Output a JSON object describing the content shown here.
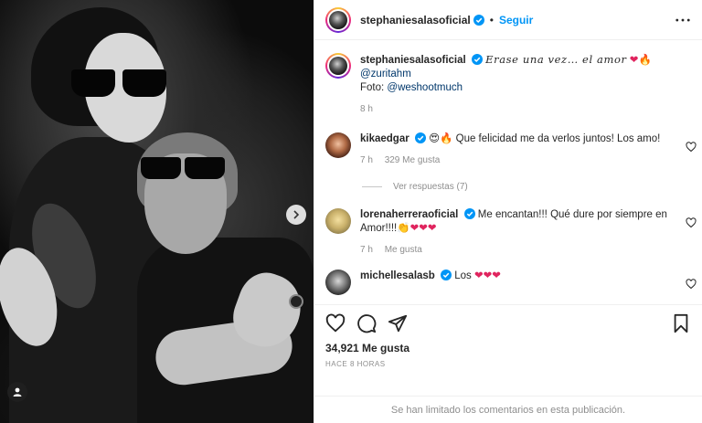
{
  "post": {
    "username": "stephaniesalasoficial",
    "follow_label": "Seguir",
    "dot": "•"
  },
  "caption": {
    "username": "stephaniesalasoficial",
    "title": "𝐸𝑟𝑎𝑠𝑒 𝑢𝑛𝑎 𝑣𝑒𝑧… 𝑒𝑙 𝑎𝑚𝑜𝑟",
    "mention": "@zuritahm",
    "photo_prefix": "Foto: ",
    "photo_credit": "@weshootmuch",
    "time": "8 h"
  },
  "comments": [
    {
      "username": "kikaedgar",
      "text": "Que felicidad me da verlos juntos! Los amo!",
      "emoji": "😍🔥",
      "time": "7 h",
      "likes": "329 Me gusta",
      "replies": "Ver respuestas (7)"
    },
    {
      "username": "lorenaherreraoficial",
      "text": "Me encantan!!! Qué dure por siempre en Amor!!!!",
      "emoji": "👏❤❤❤",
      "time": "7 h",
      "likes": "Me gusta"
    },
    {
      "username": "michellesalasb",
      "text": "Los",
      "emoji": "❤❤❤"
    }
  ],
  "footer": {
    "likes_count": "34,921 Me gusta",
    "posted_ago": "HACE 8 HORAS",
    "comments_limited": "Se han limitado los comentarios en esta publicación."
  },
  "colors": {
    "accent": "#0095f6",
    "text": "#262626",
    "muted": "#8e8e8e",
    "heart": "#e0245e"
  },
  "icons": [
    "verified-badge-icon",
    "more-options-icon",
    "heart-icon",
    "comment-icon",
    "share-icon",
    "bookmark-icon",
    "chevron-right-icon",
    "tag-user-icon"
  ]
}
